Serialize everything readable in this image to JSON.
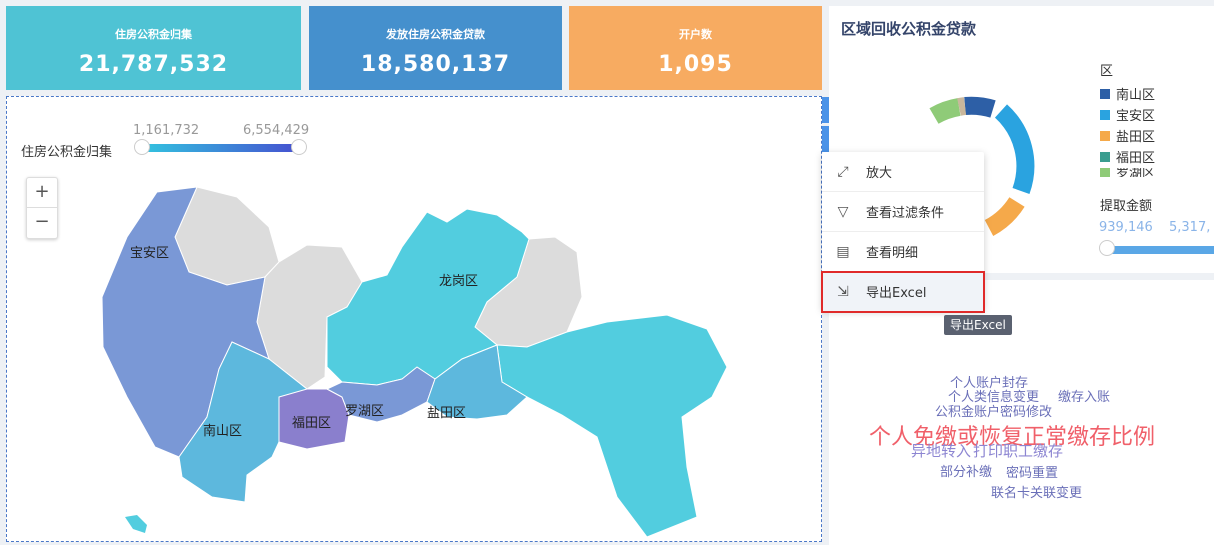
{
  "kpis": [
    {
      "title": "住房公积金归集",
      "value": "21,787,532"
    },
    {
      "title": "发放住房公积金贷款",
      "value": "18,580,137"
    },
    {
      "title": "开户数",
      "value": "1,095"
    }
  ],
  "map": {
    "visualmap_title": "住房公积金归集",
    "visualmap_min": "1,161,732",
    "visualmap_max": "6,554,429",
    "zoom_in": "+",
    "zoom_out": "−",
    "districts": [
      "宝安区",
      "龙岗区",
      "南山区",
      "福田区",
      "罗湖区",
      "盐田区"
    ]
  },
  "toolbar": {
    "undo_icon": "undo-icon",
    "dropdown_icon": "chevron-down-icon"
  },
  "menu": {
    "items": [
      {
        "label": "放大",
        "icon": "expand-icon"
      },
      {
        "label": "查看过滤条件",
        "icon": "filter-icon"
      },
      {
        "label": "查看明细",
        "icon": "detail-icon"
      },
      {
        "label": "导出Excel",
        "icon": "export-icon"
      }
    ],
    "tooltip": "导出Excel"
  },
  "donut": {
    "title": "区域回收公积金贷款",
    "legend_title": "区",
    "legend": [
      {
        "name": "南山区",
        "color": "#2d5fa6"
      },
      {
        "name": "宝安区",
        "color": "#2aa3e0"
      },
      {
        "name": "盐田区",
        "color": "#f5a94a"
      },
      {
        "name": "福田区",
        "color": "#3a9d8f"
      },
      {
        "name": "罗湖区",
        "color": "#8fcb78"
      }
    ],
    "slider_title": "提取金额",
    "slider_min": "939,146",
    "slider_max": "5,317,"
  },
  "wordcloud": [
    {
      "text": "个人账户封存"
    },
    {
      "text": "个人类信息变更"
    },
    {
      "text": "缴存入账"
    },
    {
      "text": "公积金账户密码修改"
    },
    {
      "text": "个人免缴或恢复正常缴存比例"
    },
    {
      "text": "异地转入"
    },
    {
      "text": "打印职工缴存"
    },
    {
      "text": "部分补缴"
    },
    {
      "text": "密码重置"
    },
    {
      "text": "联名卡关联变更"
    }
  ]
}
